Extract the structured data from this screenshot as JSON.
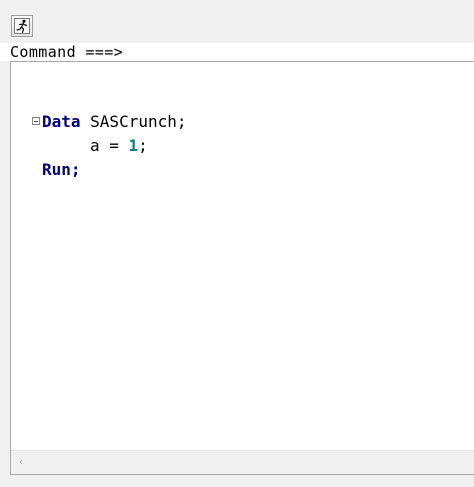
{
  "toolbar": {
    "run_icon": "running-man-icon"
  },
  "command_bar": {
    "label": "Command ===>"
  },
  "editor": {
    "fold_icon": "collapse-icon",
    "lines": [
      [
        {
          "text": "Data",
          "style": "keyword"
        },
        {
          "text": " SASCrunch;",
          "style": "plain"
        }
      ],
      [
        {
          "text": "a = ",
          "style": "plain"
        },
        {
          "text": "1",
          "style": "number"
        },
        {
          "text": ";",
          "style": "plain"
        }
      ],
      [
        {
          "text": "Run;",
          "style": "keyword"
        }
      ]
    ]
  },
  "scrollbar": {
    "left_arrow": "‹"
  },
  "colors": {
    "keyword": "#000080",
    "number": "#008080",
    "plain": "#000000"
  }
}
